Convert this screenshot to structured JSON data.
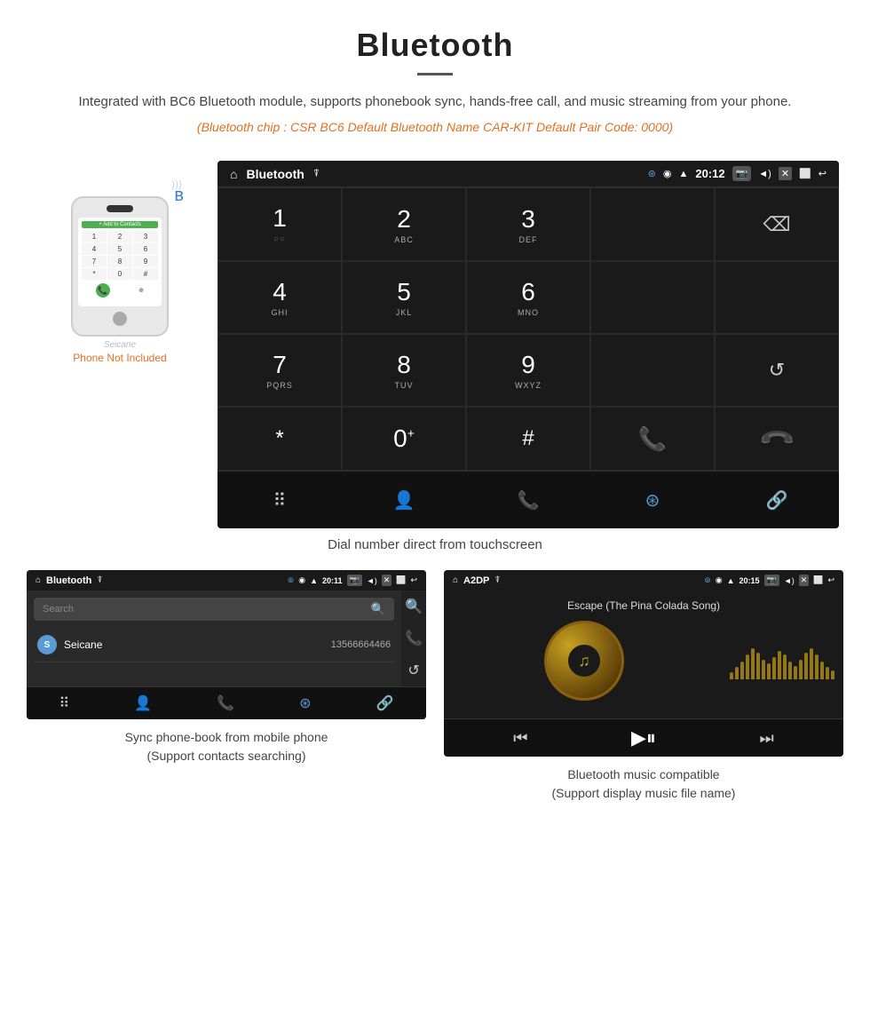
{
  "header": {
    "title": "Bluetooth",
    "description": "Integrated with BC6 Bluetooth module, supports phonebook sync, hands-free call, and music streaming from your phone.",
    "orange_info": "(Bluetooth chip : CSR BC6    Default Bluetooth Name CAR-KIT    Default Pair Code: 0000)"
  },
  "dial_screen": {
    "status_bar": {
      "app_name": "Bluetooth",
      "time": "20:12"
    },
    "keypad": [
      {
        "number": "1",
        "sub": ""
      },
      {
        "number": "2",
        "sub": "ABC"
      },
      {
        "number": "3",
        "sub": "DEF"
      },
      {
        "number": "",
        "sub": ""
      },
      {
        "number": "⌫",
        "sub": ""
      },
      {
        "number": "4",
        "sub": "GHI"
      },
      {
        "number": "5",
        "sub": "JKL"
      },
      {
        "number": "6",
        "sub": "MNO"
      },
      {
        "number": "",
        "sub": ""
      },
      {
        "number": "",
        "sub": ""
      },
      {
        "number": "7",
        "sub": "PQRS"
      },
      {
        "number": "8",
        "sub": "TUV"
      },
      {
        "number": "9",
        "sub": "WXYZ"
      },
      {
        "number": "",
        "sub": ""
      },
      {
        "number": "↺",
        "sub": ""
      },
      {
        "number": "*",
        "sub": ""
      },
      {
        "number": "0⁺",
        "sub": ""
      },
      {
        "number": "#",
        "sub": ""
      },
      {
        "number": "📞",
        "sub": "green"
      },
      {
        "number": "📞",
        "sub": "red"
      }
    ],
    "caption": "Dial number direct from touchscreen"
  },
  "phonebook_screen": {
    "status_bar": {
      "app_name": "Bluetooth",
      "time": "20:11"
    },
    "search_placeholder": "Search",
    "contact": {
      "initial": "S",
      "name": "Seicane",
      "number": "13566664466"
    },
    "caption_line1": "Sync phone-book from mobile phone",
    "caption_line2": "(Support contacts searching)"
  },
  "music_screen": {
    "status_bar": {
      "app_name": "A2DP",
      "time": "20:15"
    },
    "song_title": "Escape (The Pina Colada Song)",
    "caption_line1": "Bluetooth music compatible",
    "caption_line2": "(Support display music file name)"
  },
  "phone_mockup": {
    "seicane_label": "Seicane",
    "not_included": "Phone Not Included"
  },
  "viz_bars": [
    8,
    14,
    20,
    28,
    35,
    30,
    22,
    18,
    25,
    32,
    28,
    20,
    15,
    22,
    30,
    35,
    28,
    20,
    14,
    10
  ]
}
